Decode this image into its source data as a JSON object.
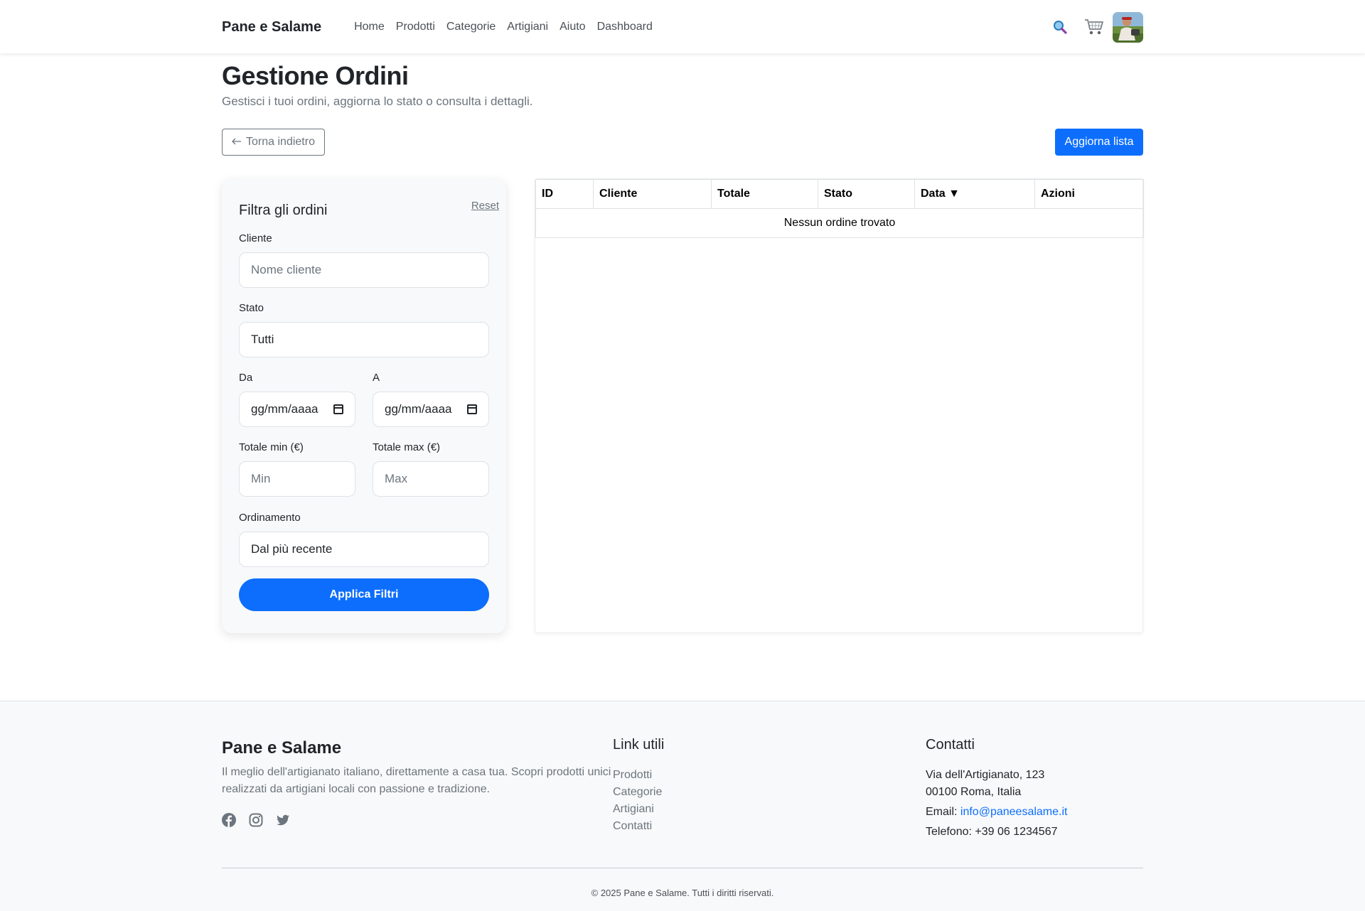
{
  "navbar": {
    "brand": "Pane e Salame",
    "links": [
      "Home",
      "Prodotti",
      "Categorie",
      "Artigiani",
      "Aiuto",
      "Dashboard"
    ]
  },
  "header": {
    "title": "Gestione Ordini",
    "subtitle": "Gestisci i tuoi ordini, aggiorna lo stato o consulta i dettagli.",
    "back_label": "Torna indietro",
    "refresh_label": "Aggiorna lista"
  },
  "filters": {
    "title": "Filtra gli ordini",
    "reset_label": "Reset",
    "cliente_label": "Cliente",
    "cliente_placeholder": "Nome cliente",
    "stato_label": "Stato",
    "stato_value": "Tutti",
    "da_label": "Da",
    "da_placeholder": "gg/mm/aaaa",
    "a_label": "A",
    "a_placeholder": "gg/mm/aaaa",
    "min_label": "Totale min (€)",
    "min_placeholder": "Min",
    "max_label": "Totale max (€)",
    "max_placeholder": "Max",
    "order_label": "Ordinamento",
    "order_value": "Dal più recente",
    "apply_label": "Applica Filtri"
  },
  "table": {
    "headers": [
      "ID",
      "Cliente",
      "Totale",
      "Stato",
      "Data ▼",
      "Azioni"
    ],
    "empty_message": "Nessun ordine trovato"
  },
  "footer": {
    "brand": "Pane e Salame",
    "description": "Il meglio dell'artigianato italiano, direttamente a casa tua. Scopri prodotti unici realizzati da artigiani locali con passione e tradizione.",
    "links_title": "Link utili",
    "links": [
      "Prodotti",
      "Categorie",
      "Artigiani",
      "Contatti"
    ],
    "contacts_title": "Contatti",
    "address_line1": "Via dell'Artigianato, 123",
    "address_line2": "00100 Roma, Italia",
    "email_label": "Email:",
    "email": "info@paneesalame.it",
    "phone": "Telefono: +39 06 1234567",
    "copyright": "© 2025 Pane e Salame. Tutti i diritti riservati."
  },
  "colors": {
    "primary": "#0d6efd",
    "muted": "#6c757d",
    "footer_bg": "#f8f9fa"
  }
}
